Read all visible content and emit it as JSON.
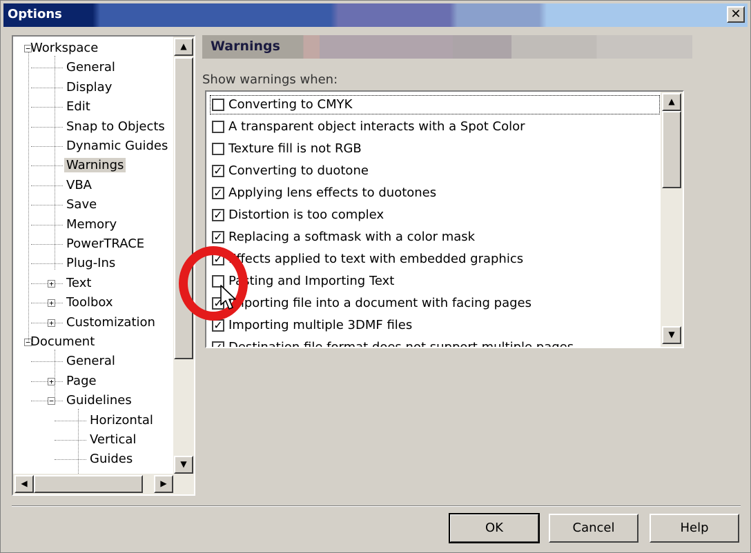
{
  "window": {
    "title": "Options",
    "close_glyph": "✕"
  },
  "tree": {
    "nodes": [
      {
        "label": "Workspace",
        "expander": "−"
      },
      {
        "label": "General"
      },
      {
        "label": "Display"
      },
      {
        "label": "Edit"
      },
      {
        "label": "Snap to Objects"
      },
      {
        "label": "Dynamic Guides"
      },
      {
        "label": "Warnings",
        "selected": true
      },
      {
        "label": "VBA"
      },
      {
        "label": "Save"
      },
      {
        "label": "Memory"
      },
      {
        "label": "PowerTRACE"
      },
      {
        "label": "Plug-Ins"
      },
      {
        "label": "Text",
        "expander": "+"
      },
      {
        "label": "Toolbox",
        "expander": "+"
      },
      {
        "label": "Customization",
        "expander": "+"
      },
      {
        "label": "Document",
        "expander": "−"
      },
      {
        "label": "General"
      },
      {
        "label": "Page",
        "expander": "+"
      },
      {
        "label": "Guidelines",
        "expander": "−"
      },
      {
        "label": "Horizontal"
      },
      {
        "label": "Vertical"
      },
      {
        "label": "Guides"
      }
    ]
  },
  "panel": {
    "header": "Warnings",
    "show_label": "Show warnings when:",
    "items": [
      {
        "label": "Converting to CMYK",
        "checked": false,
        "focused": true
      },
      {
        "label": "A transparent object interacts with a Spot Color",
        "checked": false
      },
      {
        "label": "Texture fill is not RGB",
        "checked": false
      },
      {
        "label": "Converting to duotone",
        "checked": true
      },
      {
        "label": "Applying lens effects to duotones",
        "checked": true
      },
      {
        "label": "Distortion is too complex",
        "checked": true
      },
      {
        "label": "Replacing a softmask with a color mask",
        "checked": true
      },
      {
        "label": "Effects applied to text with embedded graphics",
        "checked": true
      },
      {
        "label": "Pasting and Importing Text",
        "checked": false
      },
      {
        "label": "Importing file into a document with facing pages",
        "checked": true
      },
      {
        "label": "Importing multiple 3DMF files",
        "checked": true
      },
      {
        "label": "Destination file format does not support multiple pages",
        "checked": true
      }
    ]
  },
  "buttons": {
    "ok": "OK",
    "cancel": "Cancel",
    "help": "Help"
  },
  "glyphs": {
    "up": "▲",
    "down": "▼",
    "left": "◀",
    "right": "▶",
    "check": "✓"
  },
  "colors": {
    "annotation": "#e41b1b",
    "title_bar": "#0a246a"
  }
}
